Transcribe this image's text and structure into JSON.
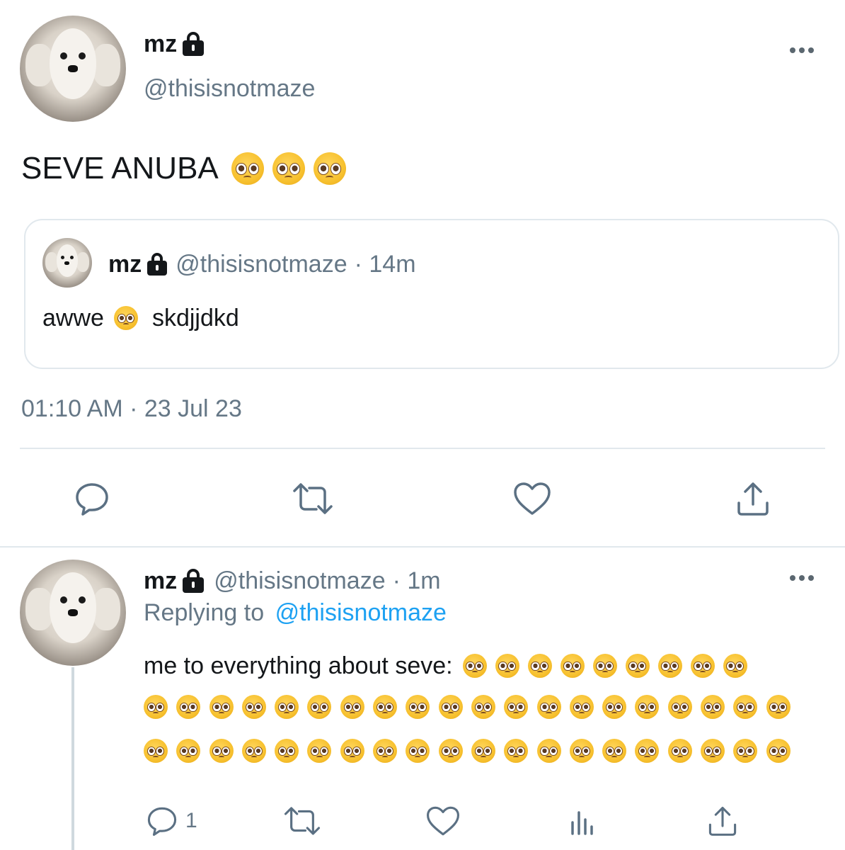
{
  "tweet": {
    "display_name": "mz",
    "handle": "@thisisnotmaze",
    "text": "SEVE ANUBA",
    "text_emoji_count": 3,
    "timestamp": "01:10 AM · 23 Jul 23",
    "quoted": {
      "display_name": "mz",
      "handle": "@thisisnotmaze",
      "time": "· 14m",
      "text_before": "awwe",
      "text_after": "skdjjdkd"
    },
    "actions": [
      "reply-icon",
      "retweet-icon",
      "like-icon",
      "share-icon"
    ]
  },
  "reply": {
    "display_name": "mz",
    "handle": "@thisisnotmaze",
    "time": "· 1m",
    "replying_label": "Replying to",
    "replying_handle": "@thisisnotmaze",
    "text": "me to everything about seve:",
    "emoji_rows": [
      9,
      20,
      20
    ],
    "reply_count": "1",
    "actions": [
      "reply-icon",
      "retweet-icon",
      "like-icon",
      "analytics-icon",
      "share-icon"
    ]
  },
  "colors": {
    "text": "#14171a",
    "muted": "#657786",
    "link": "#1da1f2",
    "border": "#e1e8ed"
  }
}
